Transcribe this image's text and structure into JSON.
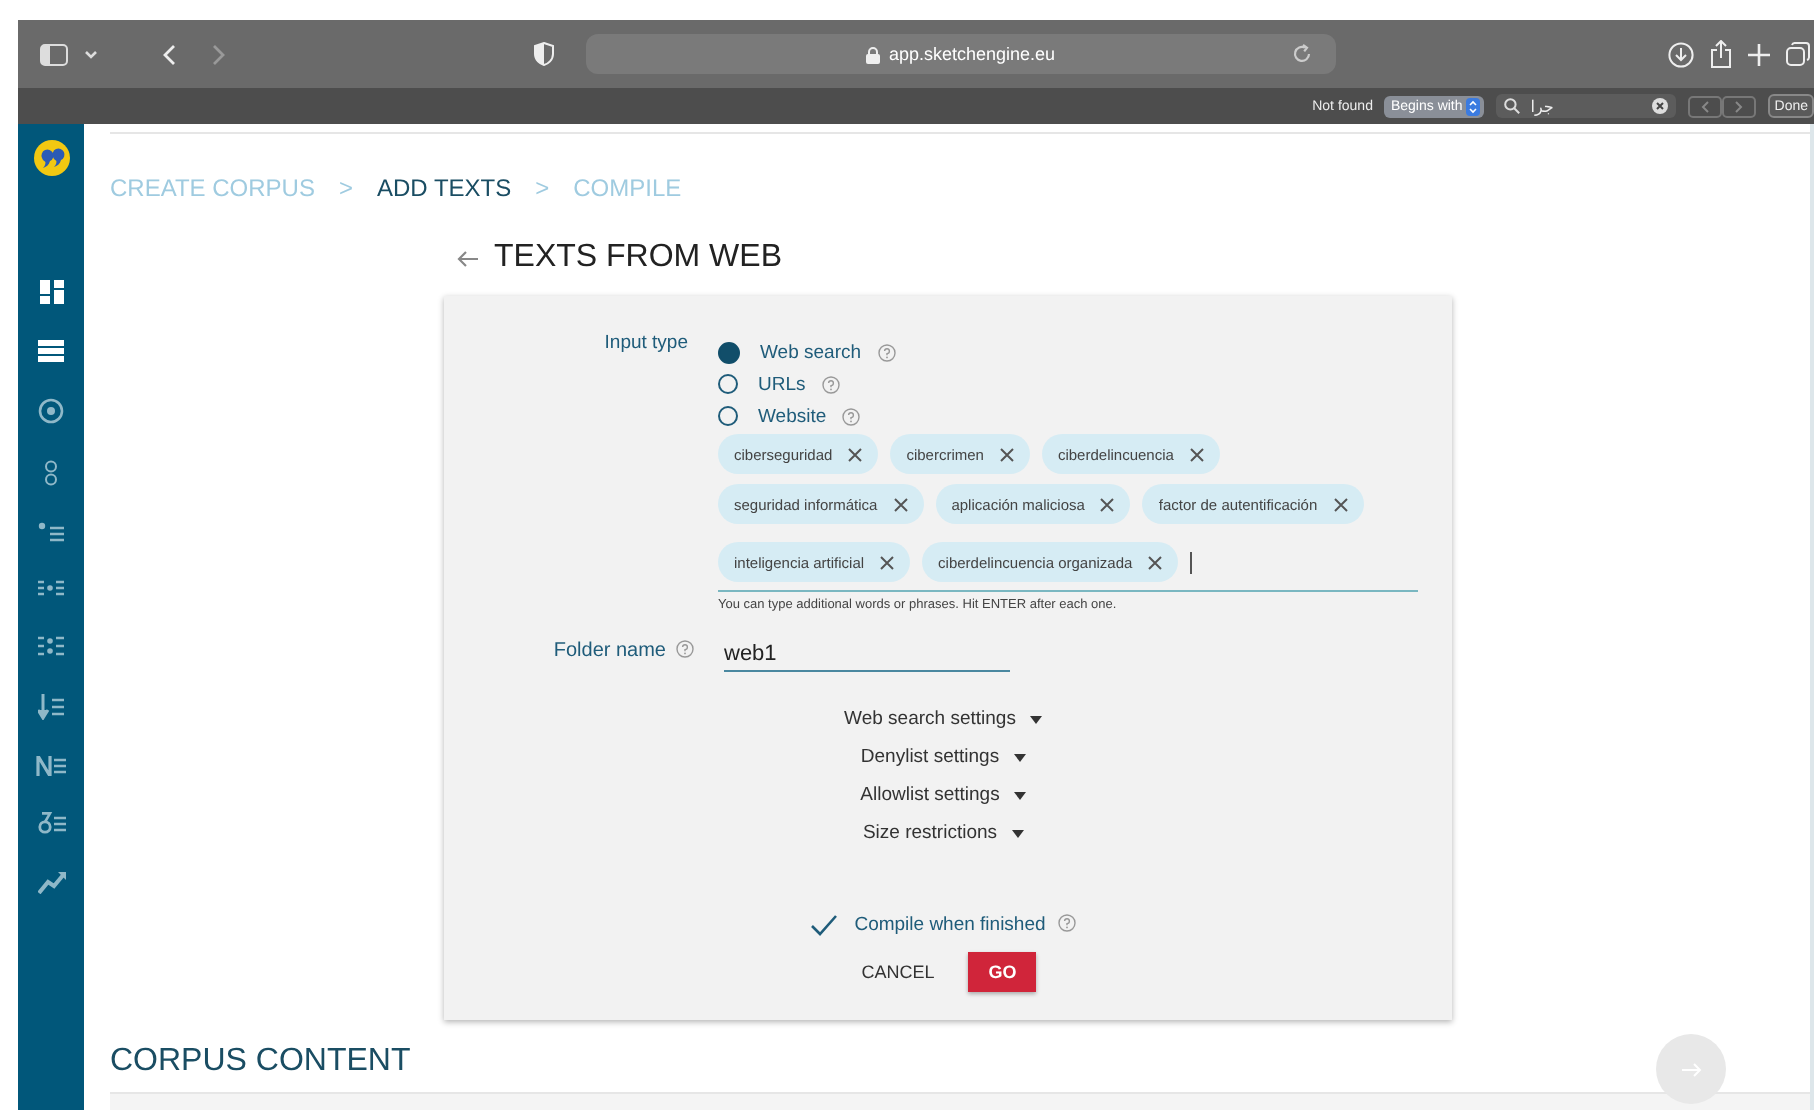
{
  "browser": {
    "address": "app.sketchengine.eu"
  },
  "find_bar": {
    "status": "Not found",
    "mode": "Begins with",
    "query": "جرا",
    "done": "Done"
  },
  "breadcrumb": {
    "separator": ">",
    "steps": [
      {
        "label": "CREATE CORPUS",
        "selected": false
      },
      {
        "label": "ADD TEXTS",
        "selected": true
      },
      {
        "label": "COMPILE",
        "selected": false
      }
    ]
  },
  "heading": "TEXTS FROM WEB",
  "form": {
    "input_type": {
      "label": "Input type",
      "options": [
        {
          "label": "Web search",
          "selected": true
        },
        {
          "label": "URLs",
          "selected": false
        },
        {
          "label": "Website",
          "selected": false
        }
      ]
    },
    "keywords": [
      "ciberseguridad",
      "cibercrimen",
      "ciberdelincuencia",
      "seguridad informática",
      "aplicación maliciosa",
      "factor de autentificación",
      "inteligencia artificial",
      "ciberdelincuencia organizada"
    ],
    "keywords_hint": "You can type additional words or phrases. Hit ENTER after each one.",
    "folder": {
      "label": "Folder name",
      "value": "web1"
    },
    "sections": [
      {
        "label": "Web search settings",
        "expanded": false
      },
      {
        "label": "Denylist settings",
        "expanded": false
      },
      {
        "label": "Allowlist settings",
        "expanded": false
      },
      {
        "label": "Size restrictions",
        "expanded": false
      }
    ],
    "compile": {
      "label": "Compile when finished",
      "checked": true
    },
    "buttons": {
      "cancel": "CANCEL",
      "go": "GO"
    }
  },
  "corpus_content": {
    "title": "CORPUS CONTENT"
  }
}
